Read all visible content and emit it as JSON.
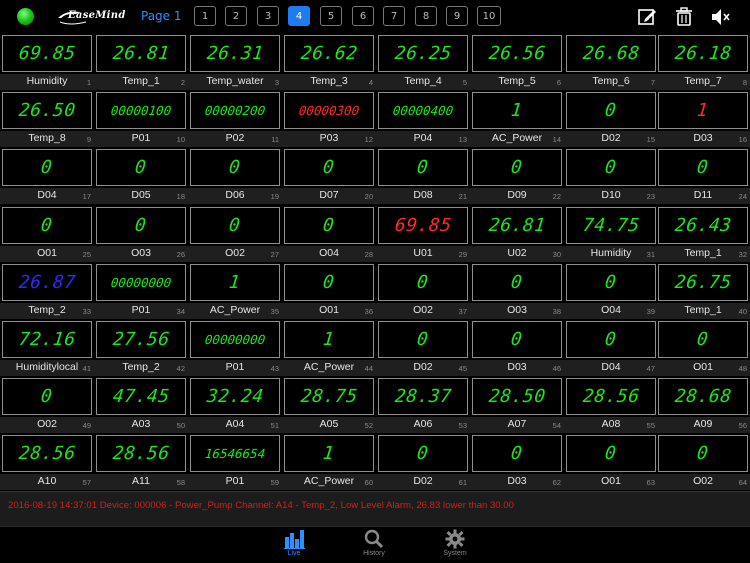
{
  "header": {
    "page_label": "Page 1",
    "brand": "EaseMind",
    "pages": [
      "1",
      "2",
      "3",
      "4",
      "5",
      "6",
      "7",
      "8",
      "9",
      "10"
    ],
    "active_page": "4"
  },
  "cells": [
    {
      "value": "69.85",
      "label": "Humidity",
      "index": "1"
    },
    {
      "value": "26.81",
      "label": "Temp_1",
      "index": "2"
    },
    {
      "value": "26.31",
      "label": "Temp_water",
      "index": "3"
    },
    {
      "value": "26.62",
      "label": "Temp_3",
      "index": "4"
    },
    {
      "value": "26.25",
      "label": "Temp_4",
      "index": "5"
    },
    {
      "value": "26.56",
      "label": "Temp_5",
      "index": "6"
    },
    {
      "value": "26.68",
      "label": "Temp_6",
      "index": "7"
    },
    {
      "value": "26.18",
      "label": "Temp_7",
      "index": "8"
    },
    {
      "value": "26.50",
      "label": "Temp_8",
      "index": "9"
    },
    {
      "value": "00000100",
      "label": "P01",
      "index": "10"
    },
    {
      "value": "00000200",
      "label": "P02",
      "index": "11"
    },
    {
      "value": "00000300",
      "label": "P03",
      "index": "12",
      "color": "red"
    },
    {
      "value": "00000400",
      "label": "P04",
      "index": "13"
    },
    {
      "value": "1",
      "label": "AC_Power",
      "index": "14"
    },
    {
      "value": "0",
      "label": "D02",
      "index": "15"
    },
    {
      "value": "1",
      "label": "D03",
      "index": "16",
      "color": "red"
    },
    {
      "value": "0",
      "label": "D04",
      "index": "17"
    },
    {
      "value": "0",
      "label": "D05",
      "index": "18"
    },
    {
      "value": "0",
      "label": "D06",
      "index": "19"
    },
    {
      "value": "0",
      "label": "D07",
      "index": "20"
    },
    {
      "value": "0",
      "label": "D08",
      "index": "21"
    },
    {
      "value": "0",
      "label": "D09",
      "index": "22"
    },
    {
      "value": "0",
      "label": "D10",
      "index": "23"
    },
    {
      "value": "0",
      "label": "D11",
      "index": "24"
    },
    {
      "value": "0",
      "label": "O01",
      "index": "25"
    },
    {
      "value": "0",
      "label": "O03",
      "index": "26"
    },
    {
      "value": "0",
      "label": "O02",
      "index": "27"
    },
    {
      "value": "0",
      "label": "O04",
      "index": "28"
    },
    {
      "value": "69.85",
      "label": "U01",
      "index": "29",
      "color": "red"
    },
    {
      "value": "26.81",
      "label": "U02",
      "index": "30"
    },
    {
      "value": "74.75",
      "label": "Humidity",
      "index": "31"
    },
    {
      "value": "26.43",
      "label": "Temp_1",
      "index": "32"
    },
    {
      "value": "26.87",
      "label": "Temp_2",
      "index": "33",
      "color": "blue"
    },
    {
      "value": "00000000",
      "label": "P01",
      "index": "34"
    },
    {
      "value": "1",
      "label": "AC_Power",
      "index": "35"
    },
    {
      "value": "0",
      "label": "O01",
      "index": "36"
    },
    {
      "value": "0",
      "label": "O02",
      "index": "37"
    },
    {
      "value": "0",
      "label": "O03",
      "index": "38"
    },
    {
      "value": "0",
      "label": "O04",
      "index": "39"
    },
    {
      "value": "26.75",
      "label": "Temp_1",
      "index": "40"
    },
    {
      "value": "72.16",
      "label": "Humiditylocal",
      "index": "41"
    },
    {
      "value": "27.56",
      "label": "Temp_2",
      "index": "42"
    },
    {
      "value": "00000000",
      "label": "P01",
      "index": "43"
    },
    {
      "value": "1",
      "label": "AC_Power",
      "index": "44"
    },
    {
      "value": "0",
      "label": "D02",
      "index": "45"
    },
    {
      "value": "0",
      "label": "D03",
      "index": "46"
    },
    {
      "value": "0",
      "label": "D04",
      "index": "47"
    },
    {
      "value": "0",
      "label": "O01",
      "index": "48"
    },
    {
      "value": "0",
      "label": "O02",
      "index": "49"
    },
    {
      "value": "47.45",
      "label": "A03",
      "index": "50"
    },
    {
      "value": "32.24",
      "label": "A04",
      "index": "51"
    },
    {
      "value": "28.75",
      "label": "A05",
      "index": "52"
    },
    {
      "value": "28.37",
      "label": "A06",
      "index": "53"
    },
    {
      "value": "28.50",
      "label": "A07",
      "index": "54"
    },
    {
      "value": "28.56",
      "label": "A08",
      "index": "55"
    },
    {
      "value": "28.68",
      "label": "A09",
      "index": "56"
    },
    {
      "value": "28.56",
      "label": "A10",
      "index": "57"
    },
    {
      "value": "28.56",
      "label": "A11",
      "index": "58"
    },
    {
      "value": "16546654",
      "label": "P01",
      "index": "59"
    },
    {
      "value": "1",
      "label": "AC_Power",
      "index": "60"
    },
    {
      "value": "0",
      "label": "D02",
      "index": "61"
    },
    {
      "value": "0",
      "label": "D03",
      "index": "62"
    },
    {
      "value": "0",
      "label": "O01",
      "index": "63"
    },
    {
      "value": "0",
      "label": "O02",
      "index": "64"
    }
  ],
  "alarm": {
    "text": "2016-08-19 14:37:01 Device: 000006 - Power_Pump   Channel: A14 - Temp_2, Low Level Alarm, 26.83 lower than 30.00"
  },
  "tabs": [
    {
      "label": "Live",
      "icon": "bar-chart-icon",
      "active": true
    },
    {
      "label": "History",
      "icon": "search-icon",
      "active": false
    },
    {
      "label": "System",
      "icon": "gear-icon",
      "active": false
    }
  ],
  "colors": {
    "digit_green": "#1ce61c",
    "digit_red": "#ff2a2a",
    "digit_blue": "#2b2bff",
    "accent_blue": "#1e7bf2",
    "alarm_red": "#d61e1e"
  }
}
